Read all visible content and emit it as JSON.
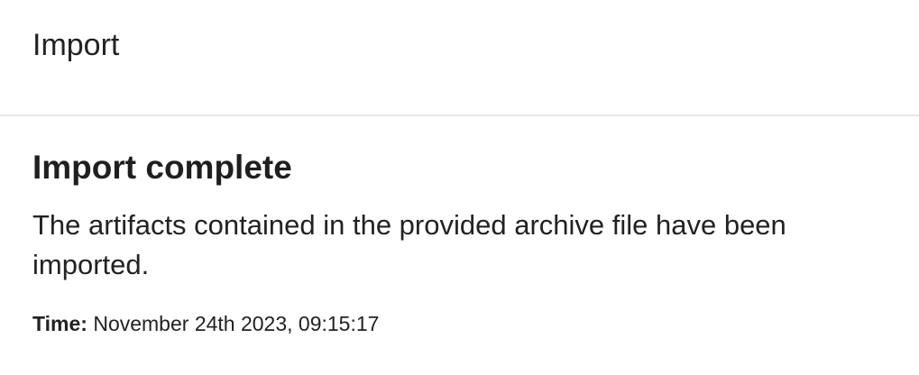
{
  "header": {
    "title": "Import"
  },
  "result": {
    "heading": "Import complete",
    "message": "The artifacts contained in the provided archive file have been imported.",
    "time_label": "Time:",
    "time_value": "November 24th 2023, 09:15:17"
  }
}
